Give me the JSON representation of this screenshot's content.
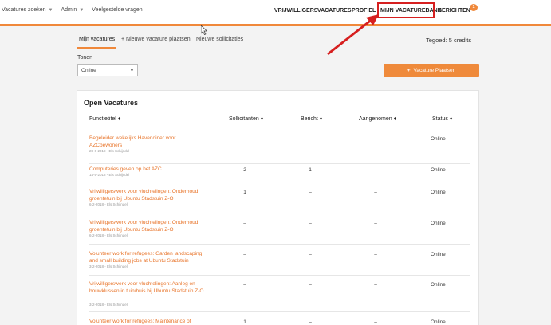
{
  "nav_left": [
    {
      "label": "Vacatures zoeken",
      "has_dropdown": true
    },
    {
      "label": "Admin",
      "has_dropdown": true
    },
    {
      "label": "Veelgestelde vragen",
      "has_dropdown": false
    }
  ],
  "nav_right": {
    "vrijwilligers": "VRIJWILLIGERS",
    "vacatures": "VACATURES",
    "profiel": "PROFIEL",
    "mijn_vacaturebank": "MIJN VACATUREBANK",
    "berichten": "BERICHTEN",
    "notification_count": "1"
  },
  "tabs": {
    "mijn_vacatures": "Mijn vacatures",
    "nieuwe_vacature": "+ Nieuwe vacature plaatsen",
    "nieuwe_sollicitaties": "Nieuwe sollicitaties"
  },
  "credits": "Tegoed: 5 credits",
  "filter": {
    "label": "Tonen",
    "selected": "Online"
  },
  "place_button": {
    "icon": "plus-icon",
    "label": "Vacature Plaatsen"
  },
  "panel": {
    "title": "Open Vacatures",
    "columns": {
      "functietitel": "Functietitel",
      "sollicitanten": "Sollicitanten",
      "bericht": "Bericht",
      "aangenomen": "Aangenomen",
      "status": "Status"
    },
    "sort_icon": "sort-icon",
    "rows": [
      {
        "title": "Begeleider wekelijks Havendiner voor AZCbewoners",
        "meta": "28-6-2018 - Els Schijndel",
        "sollicitanten": "–",
        "bericht": "–",
        "aangenomen": "–",
        "status": "Online"
      },
      {
        "title": "Computeries geven op het AZC",
        "meta": "14-5-2018 - Els Schijndel",
        "sollicitanten": "2",
        "bericht": "1",
        "aangenomen": "–",
        "status": "Online"
      },
      {
        "title": "Vrijwilligerswerk voor vluchtelingen: Onderhoud groentetuin bij Ubuntu Stadstuin Z-O",
        "meta": "6-2-2018 - Els Schijndel",
        "sollicitanten": "1",
        "bericht": "–",
        "aangenomen": "–",
        "status": "Online"
      },
      {
        "title": "Vrijwilligerswerk voor vluchtelingen: Onderhoud groentetuin bij Ubuntu Stadstuin Z-O",
        "meta": "6-2-2018 - Els Schijndel",
        "sollicitanten": "–",
        "bericht": "–",
        "aangenomen": "–",
        "status": "Online"
      },
      {
        "title": "Volunteer work for refugees: Garden landscaping and small building jobs at Ubuntu Stadstuin",
        "meta": "3-2-2018 - Els Schijndel",
        "sollicitanten": "–",
        "bericht": "–",
        "aangenomen": "–",
        "status": "Online"
      },
      {
        "title": "Vrijwilligerswerk voor vluchtelingen: Aanleg en bouwklussen in tuin/huis bij Ubuntu Stadstuin Z-O",
        "meta": "3-2-2018 - Els Schijndel",
        "sollicitanten": "–",
        "bericht": "–",
        "aangenomen": "–",
        "status": "Online"
      },
      {
        "title": "Volunteer work for refugees: Maintenance of",
        "meta": "",
        "sollicitanten": "1",
        "bericht": "–",
        "aangenomen": "–",
        "status": "Online"
      }
    ]
  },
  "colors": {
    "accent": "#f0883a",
    "link": "#e8742a",
    "annotation": "#d61f1f"
  }
}
